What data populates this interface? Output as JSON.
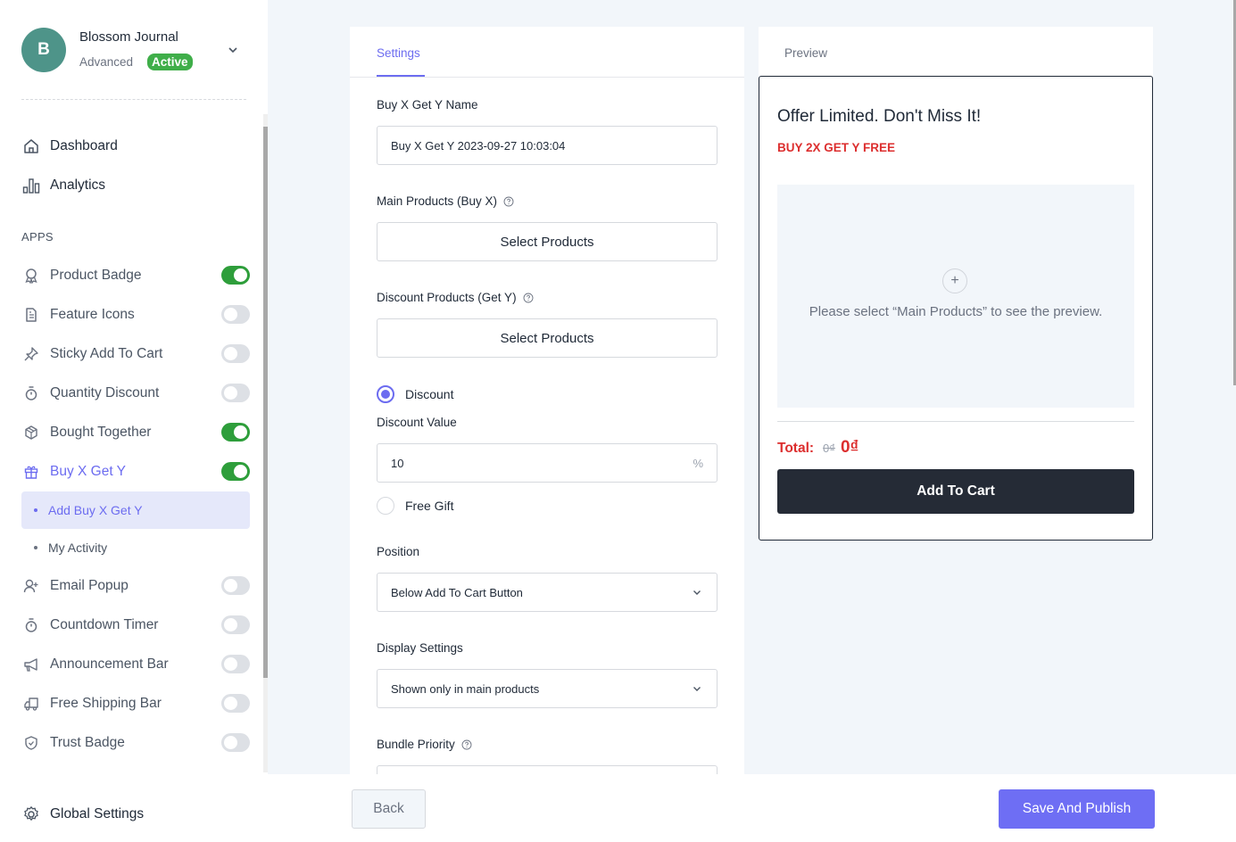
{
  "account": {
    "avatar_letter": "B",
    "name": "Blossom Journal",
    "plan": "Advanced",
    "status_badge": "Active"
  },
  "nav": {
    "dashboard": "Dashboard",
    "analytics": "Analytics",
    "apps_heading": "APPS",
    "global_settings": "Global Settings"
  },
  "apps": [
    {
      "label": "Product Badge",
      "icon": "award-icon",
      "enabled": true
    },
    {
      "label": "Feature Icons",
      "icon": "file-text-icon",
      "enabled": false
    },
    {
      "label": "Sticky Add To Cart",
      "icon": "pin-icon",
      "enabled": false
    },
    {
      "label": "Quantity Discount",
      "icon": "stopwatch-icon",
      "enabled": false
    },
    {
      "label": "Bought Together",
      "icon": "box-icon",
      "enabled": true
    },
    {
      "label": "Buy X Get Y",
      "icon": "gift-icon",
      "enabled": true,
      "active": true
    },
    {
      "label": "Email Popup",
      "icon": "user-plus-icon",
      "enabled": false
    },
    {
      "label": "Countdown Timer",
      "icon": "stopwatch-icon",
      "enabled": false
    },
    {
      "label": "Announcement Bar",
      "icon": "megaphone-icon",
      "enabled": false
    },
    {
      "label": "Free Shipping Bar",
      "icon": "truck-icon",
      "enabled": false
    },
    {
      "label": "Trust Badge",
      "icon": "shield-check-icon",
      "enabled": false
    }
  ],
  "buyxgety_submenu": [
    {
      "label": "Add Buy X Get Y",
      "selected": true
    },
    {
      "label": "My Activity",
      "selected": false
    }
  ],
  "settings": {
    "tab": "Settings",
    "name_label": "Buy X Get Y Name",
    "name_value": "Buy X Get Y 2023-09-27 10:03:04",
    "main_products_label": "Main Products (Buy X)",
    "main_products_button": "Select Products",
    "discount_products_label": "Discount Products (Get Y)",
    "discount_products_button": "Select Products",
    "discount_option": "Discount",
    "discount_selected": true,
    "discount_value_label": "Discount Value",
    "discount_value": "10",
    "discount_suffix": "%",
    "free_gift_option": "Free Gift",
    "position_label": "Position",
    "position_value": "Below Add To Cart Button",
    "display_label": "Display Settings",
    "display_value": "Shown only in main products",
    "bundle_priority_label": "Bundle Priority"
  },
  "preview": {
    "tab": "Preview",
    "title": "Offer Limited. Don't Miss It!",
    "subtitle": "BUY 2X GET Y FREE",
    "hint": "Please select “Main Products” to see the preview.",
    "total_label": "Total:",
    "old_price": "0₫",
    "new_price": "0₫",
    "add_to_cart": "Add To Cart"
  },
  "footer": {
    "back": "Back",
    "save": "Save And Publish"
  }
}
